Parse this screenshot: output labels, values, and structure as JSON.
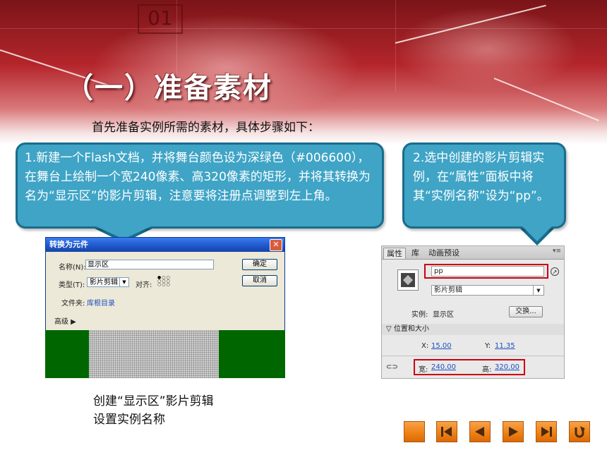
{
  "slide": {
    "banner_numeral": "01",
    "title": "（一）准备素材",
    "intro": "首先准备实例所需的素材，具体步骤如下：",
    "callout1_text": "1.新建一个Flash文档，并将舞台颜色设为深绿色（#006600），在舞台上绘制一个宽240像素、高320像素的矩形，并将其转换为名为“显示区”的影片剪辑，注意要将注册点调整到左上角。",
    "callout2_text": "2.选中创建的影片剪辑实例，在“属性”面板中将其“实例名称”设为“pp”。",
    "caption_line1": "创建“显示区”影片剪辑",
    "caption_line2": "设置实例名称"
  },
  "dialog": {
    "title": "转换为元件",
    "close_glyph": "✕",
    "name_label": "名称(N):",
    "name_value": "显示区",
    "ok_label": "确定",
    "type_label": "类型(T):",
    "type_value": "影片剪辑",
    "align_label": "对齐:",
    "cancel_label": "取消",
    "folder_label": "文件夹:",
    "folder_value": "库根目录",
    "advanced_label": "高级 ▶"
  },
  "properties_panel": {
    "tabs": [
      "属性",
      "库",
      "动画预设"
    ],
    "menu_glyph": "▾≡",
    "instance_name": "pp",
    "symbol_type": "影片剪辑",
    "instance_label": "实例:",
    "instance_value": "显示区",
    "swap_button": "交换...",
    "section_title": "▽ 位置和大小",
    "x_label": "X:",
    "x_value": "15.00",
    "y_label": "Y:",
    "y_value": "11.35",
    "w_label": "宽:",
    "w_value": "240.00",
    "h_label": "高:",
    "h_value": "320.00"
  },
  "colors": {
    "callout_fill": "#3fa4c6",
    "callout_border": "#1a6c8c",
    "stage_green": "#006600",
    "highlight_red": "#cc0010",
    "nav_orange": "#ee7f12"
  },
  "nav_buttons": [
    "stop-icon",
    "first-slide-icon",
    "previous-icon",
    "next-icon",
    "last-slide-icon",
    "return-icon"
  ]
}
